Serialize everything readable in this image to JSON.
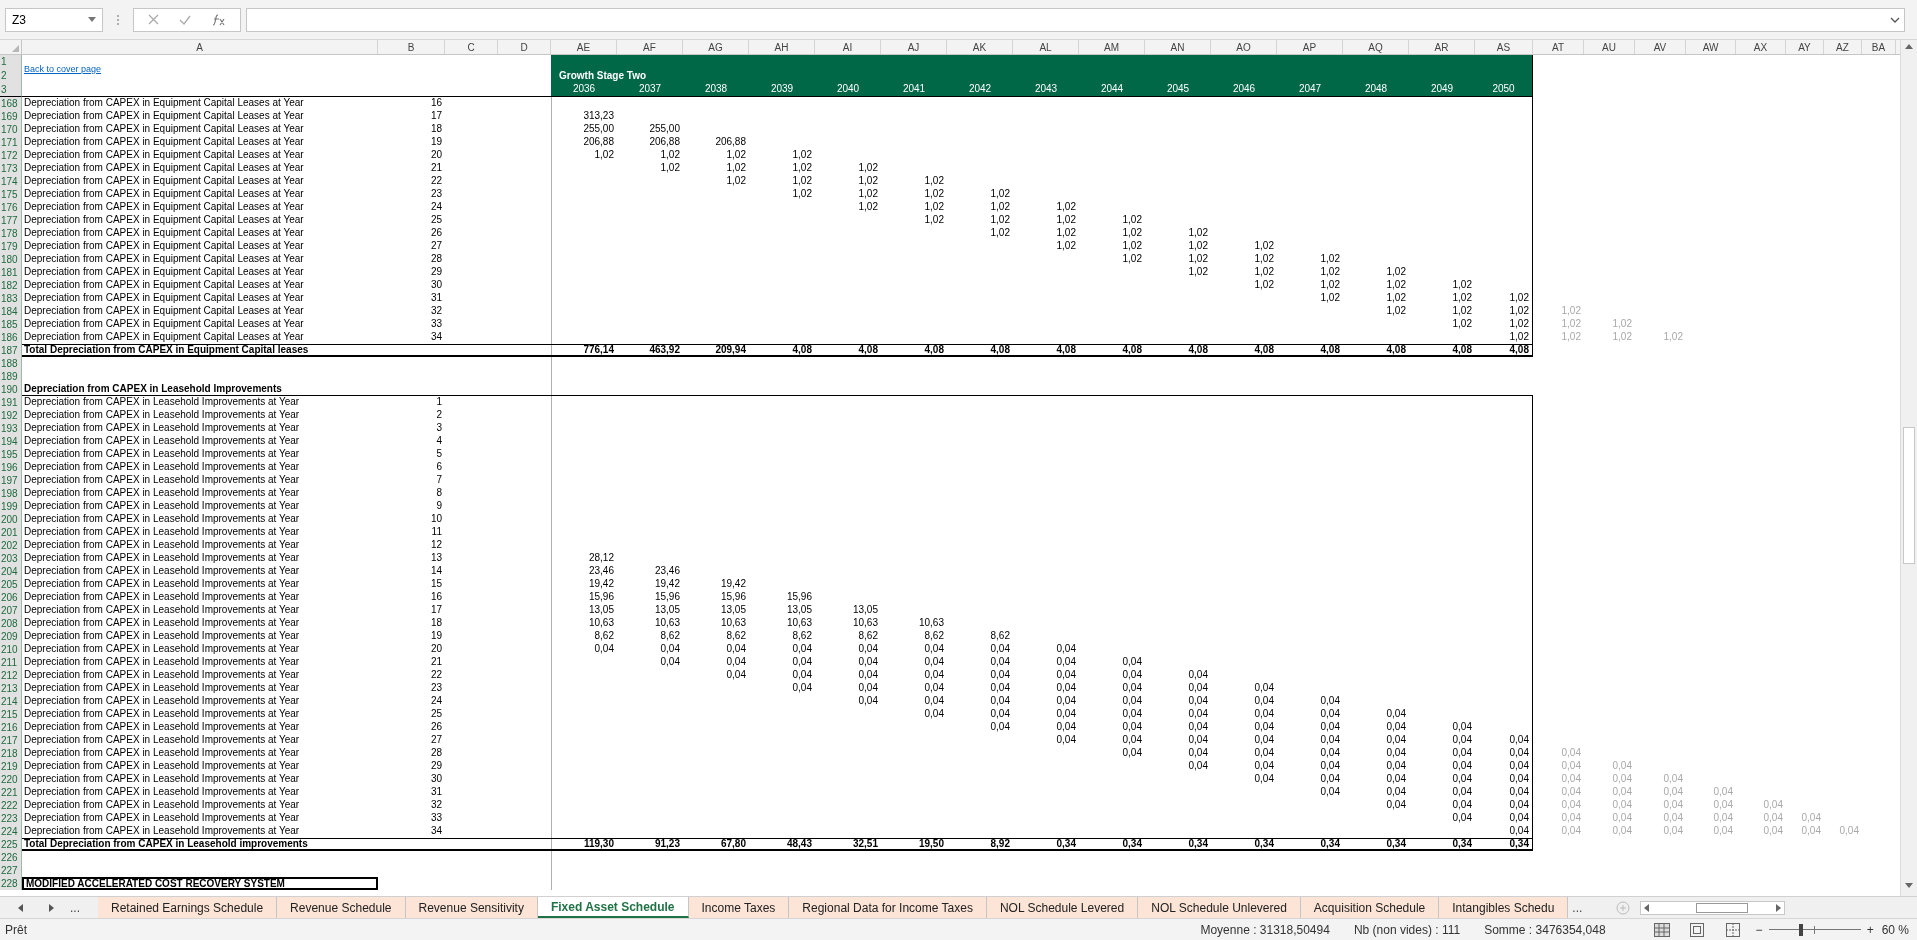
{
  "formula_bar": {
    "name_box": "Z3"
  },
  "columns": [
    {
      "letter": "A"
    },
    {
      "letter": "B"
    },
    {
      "letter": "C"
    },
    {
      "letter": "D"
    },
    {
      "letter": "AE"
    },
    {
      "letter": "AF"
    },
    {
      "letter": "AG"
    },
    {
      "letter": "AH"
    },
    {
      "letter": "AI"
    },
    {
      "letter": "AJ"
    },
    {
      "letter": "AK"
    },
    {
      "letter": "AL"
    },
    {
      "letter": "AM"
    },
    {
      "letter": "AN"
    },
    {
      "letter": "AO"
    },
    {
      "letter": "AP"
    },
    {
      "letter": "AQ"
    },
    {
      "letter": "AR"
    },
    {
      "letter": "AS"
    },
    {
      "letter": "AT",
      "dimmed": true
    },
    {
      "letter": "AU",
      "dimmed": true
    },
    {
      "letter": "AV",
      "dimmed": true
    },
    {
      "letter": "AW",
      "dimmed": true
    },
    {
      "letter": "AX",
      "dimmed": true
    },
    {
      "letter": "AY",
      "dimmed": true
    },
    {
      "letter": "AZ",
      "dimmed": true
    },
    {
      "letter": "BA"
    }
  ],
  "header": {
    "row_numbers": [
      "1",
      "2",
      "3"
    ],
    "link": "Back to cover page",
    "band_title": "Growth Stage Two",
    "years": [
      "2036",
      "2037",
      "2038",
      "2039",
      "2040",
      "2041",
      "2042",
      "2043",
      "2044",
      "2045",
      "2046",
      "2047",
      "2048",
      "2049",
      "2050"
    ]
  },
  "rows": [
    {
      "num": "168",
      "kind": "item",
      "cells": {
        "A": "Depreciation from CAPEX in Equipment Capital Leases at Year",
        "B": "16"
      }
    },
    {
      "num": "169",
      "kind": "item",
      "cells": {
        "A": "Depreciation from CAPEX in Equipment Capital Leases at Year",
        "B": "17",
        "AE": "313,23"
      }
    },
    {
      "num": "170",
      "kind": "item",
      "cells": {
        "A": "Depreciation from CAPEX in Equipment Capital Leases at Year",
        "B": "18",
        "AE": "255,00",
        "AF": "255,00"
      }
    },
    {
      "num": "171",
      "kind": "item",
      "cells": {
        "A": "Depreciation from CAPEX in Equipment Capital Leases at Year",
        "B": "19",
        "AE": "206,88",
        "AF": "206,88",
        "AG": "206,88"
      }
    },
    {
      "num": "172",
      "kind": "item",
      "cells": {
        "A": "Depreciation from CAPEX in Equipment Capital Leases at Year",
        "B": "20",
        "AE": "1,02",
        "AF": "1,02",
        "AG": "1,02",
        "AH": "1,02"
      }
    },
    {
      "num": "173",
      "kind": "item",
      "cells": {
        "A": "Depreciation from CAPEX in Equipment Capital Leases at Year",
        "B": "21",
        "AF": "1,02",
        "AG": "1,02",
        "AH": "1,02",
        "AI": "1,02"
      }
    },
    {
      "num": "174",
      "kind": "item",
      "cells": {
        "A": "Depreciation from CAPEX in Equipment Capital Leases at Year",
        "B": "22",
        "AG": "1,02",
        "AH": "1,02",
        "AI": "1,02",
        "AJ": "1,02"
      }
    },
    {
      "num": "175",
      "kind": "item",
      "cells": {
        "A": "Depreciation from CAPEX in Equipment Capital Leases at Year",
        "B": "23",
        "AH": "1,02",
        "AI": "1,02",
        "AJ": "1,02",
        "AK": "1,02"
      }
    },
    {
      "num": "176",
      "kind": "item",
      "cells": {
        "A": "Depreciation from CAPEX in Equipment Capital Leases at Year",
        "B": "24",
        "AI": "1,02",
        "AJ": "1,02",
        "AK": "1,02",
        "AL": "1,02"
      }
    },
    {
      "num": "177",
      "kind": "item",
      "cells": {
        "A": "Depreciation from CAPEX in Equipment Capital Leases at Year",
        "B": "25",
        "AJ": "1,02",
        "AK": "1,02",
        "AL": "1,02",
        "AM": "1,02"
      }
    },
    {
      "num": "178",
      "kind": "item",
      "cells": {
        "A": "Depreciation from CAPEX in Equipment Capital Leases at Year",
        "B": "26",
        "AK": "1,02",
        "AL": "1,02",
        "AM": "1,02",
        "AN": "1,02"
      }
    },
    {
      "num": "179",
      "kind": "item",
      "cells": {
        "A": "Depreciation from CAPEX in Equipment Capital Leases at Year",
        "B": "27",
        "AL": "1,02",
        "AM": "1,02",
        "AN": "1,02",
        "AO": "1,02"
      }
    },
    {
      "num": "180",
      "kind": "item",
      "cells": {
        "A": "Depreciation from CAPEX in Equipment Capital Leases at Year",
        "B": "28",
        "AM": "1,02",
        "AN": "1,02",
        "AO": "1,02",
        "AP": "1,02"
      }
    },
    {
      "num": "181",
      "kind": "item",
      "cells": {
        "A": "Depreciation from CAPEX in Equipment Capital Leases at Year",
        "B": "29",
        "AN": "1,02",
        "AO": "1,02",
        "AP": "1,02",
        "AQ": "1,02"
      }
    },
    {
      "num": "182",
      "kind": "item",
      "cells": {
        "A": "Depreciation from CAPEX in Equipment Capital Leases at Year",
        "B": "30",
        "AO": "1,02",
        "AP": "1,02",
        "AQ": "1,02",
        "AR": "1,02"
      }
    },
    {
      "num": "183",
      "kind": "item",
      "cells": {
        "A": "Depreciation from CAPEX in Equipment Capital Leases at Year",
        "B": "31",
        "AP": "1,02",
        "AQ": "1,02",
        "AR": "1,02",
        "AS": "1,02"
      }
    },
    {
      "num": "184",
      "kind": "item",
      "cells": {
        "A": "Depreciation from CAPEX in Equipment Capital Leases at Year",
        "B": "32",
        "AQ": "1,02",
        "AR": "1,02",
        "AS": "1,02",
        "AT": "1,02"
      }
    },
    {
      "num": "185",
      "kind": "item",
      "cells": {
        "A": "Depreciation from CAPEX in Equipment Capital Leases at Year",
        "B": "33",
        "AR": "1,02",
        "AS": "1,02",
        "AT": "1,02",
        "AU": "1,02"
      }
    },
    {
      "num": "186",
      "kind": "item",
      "cells": {
        "A": "Depreciation from CAPEX in Equipment Capital Leases at Year",
        "B": "34",
        "AS": "1,02",
        "AT": "1,02",
        "AU": "1,02",
        "AV": "1,02"
      }
    },
    {
      "num": "187",
      "kind": "total",
      "cells": {
        "A": "Total Depreciation from CAPEX in Equipment Capital leases",
        "AE": "776,14",
        "AF": "463,92",
        "AG": "209,94",
        "AH": "4,08",
        "AI": "4,08",
        "AJ": "4,08",
        "AK": "4,08",
        "AL": "4,08",
        "AM": "4,08",
        "AN": "4,08",
        "AO": "4,08",
        "AP": "4,08",
        "AQ": "4,08",
        "AR": "4,08",
        "AS": "4,08"
      }
    },
    {
      "num": "188",
      "kind": "blank"
    },
    {
      "num": "189",
      "kind": "blank"
    },
    {
      "num": "190",
      "kind": "section",
      "cells": {
        "A": "Depreciation from CAPEX in Leasehold Improvements"
      }
    },
    {
      "num": "191",
      "kind": "item",
      "cells": {
        "A": "Depreciation from CAPEX in Leasehold Improvements at Year",
        "B": "1"
      }
    },
    {
      "num": "192",
      "kind": "item",
      "cells": {
        "A": "Depreciation from CAPEX in Leasehold Improvements at Year",
        "B": "2"
      }
    },
    {
      "num": "193",
      "kind": "item",
      "cells": {
        "A": "Depreciation from CAPEX in Leasehold Improvements at Year",
        "B": "3"
      }
    },
    {
      "num": "194",
      "kind": "item",
      "cells": {
        "A": "Depreciation from CAPEX in Leasehold Improvements at Year",
        "B": "4"
      }
    },
    {
      "num": "195",
      "kind": "item",
      "cells": {
        "A": "Depreciation from CAPEX in Leasehold Improvements at Year",
        "B": "5"
      }
    },
    {
      "num": "196",
      "kind": "item",
      "cells": {
        "A": "Depreciation from CAPEX in Leasehold Improvements at Year",
        "B": "6"
      }
    },
    {
      "num": "197",
      "kind": "item",
      "cells": {
        "A": "Depreciation from CAPEX in Leasehold Improvements at Year",
        "B": "7"
      }
    },
    {
      "num": "198",
      "kind": "item",
      "cells": {
        "A": "Depreciation from CAPEX in Leasehold Improvements at Year",
        "B": "8"
      }
    },
    {
      "num": "199",
      "kind": "item",
      "cells": {
        "A": "Depreciation from CAPEX in Leasehold Improvements at Year",
        "B": "9"
      }
    },
    {
      "num": "200",
      "kind": "item",
      "cells": {
        "A": "Depreciation from CAPEX in Leasehold Improvements at Year",
        "B": "10"
      }
    },
    {
      "num": "201",
      "kind": "item",
      "cells": {
        "A": "Depreciation from CAPEX in Leasehold Improvements at Year",
        "B": "11"
      }
    },
    {
      "num": "202",
      "kind": "item",
      "cells": {
        "A": "Depreciation from CAPEX in Leasehold Improvements at Year",
        "B": "12"
      }
    },
    {
      "num": "203",
      "kind": "item",
      "cells": {
        "A": "Depreciation from CAPEX in Leasehold Improvements at Year",
        "B": "13",
        "AE": "28,12"
      }
    },
    {
      "num": "204",
      "kind": "item",
      "cells": {
        "A": "Depreciation from CAPEX in Leasehold Improvements at Year",
        "B": "14",
        "AE": "23,46",
        "AF": "23,46"
      }
    },
    {
      "num": "205",
      "kind": "item",
      "cells": {
        "A": "Depreciation from CAPEX in Leasehold Improvements at Year",
        "B": "15",
        "AE": "19,42",
        "AF": "19,42",
        "AG": "19,42"
      }
    },
    {
      "num": "206",
      "kind": "item",
      "cells": {
        "A": "Depreciation from CAPEX in Leasehold Improvements at Year",
        "B": "16",
        "AE": "15,96",
        "AF": "15,96",
        "AG": "15,96",
        "AH": "15,96"
      }
    },
    {
      "num": "207",
      "kind": "item",
      "cells": {
        "A": "Depreciation from CAPEX in Leasehold Improvements at Year",
        "B": "17",
        "AE": "13,05",
        "AF": "13,05",
        "AG": "13,05",
        "AH": "13,05",
        "AI": "13,05"
      }
    },
    {
      "num": "208",
      "kind": "item",
      "cells": {
        "A": "Depreciation from CAPEX in Leasehold Improvements at Year",
        "B": "18",
        "AE": "10,63",
        "AF": "10,63",
        "AG": "10,63",
        "AH": "10,63",
        "AI": "10,63",
        "AJ": "10,63"
      }
    },
    {
      "num": "209",
      "kind": "item",
      "cells": {
        "A": "Depreciation from CAPEX in Leasehold Improvements at Year",
        "B": "19",
        "AE": "8,62",
        "AF": "8,62",
        "AG": "8,62",
        "AH": "8,62",
        "AI": "8,62",
        "AJ": "8,62",
        "AK": "8,62"
      }
    },
    {
      "num": "210",
      "kind": "item",
      "cells": {
        "A": "Depreciation from CAPEX in Leasehold Improvements at Year",
        "B": "20",
        "AE": "0,04",
        "AF": "0,04",
        "AG": "0,04",
        "AH": "0,04",
        "AI": "0,04",
        "AJ": "0,04",
        "AK": "0,04",
        "AL": "0,04"
      }
    },
    {
      "num": "211",
      "kind": "item",
      "cells": {
        "A": "Depreciation from CAPEX in Leasehold Improvements at Year",
        "B": "21",
        "AF": "0,04",
        "AG": "0,04",
        "AH": "0,04",
        "AI": "0,04",
        "AJ": "0,04",
        "AK": "0,04",
        "AL": "0,04",
        "AM": "0,04"
      }
    },
    {
      "num": "212",
      "kind": "item",
      "cells": {
        "A": "Depreciation from CAPEX in Leasehold Improvements at Year",
        "B": "22",
        "AG": "0,04",
        "AH": "0,04",
        "AI": "0,04",
        "AJ": "0,04",
        "AK": "0,04",
        "AL": "0,04",
        "AM": "0,04",
        "AN": "0,04"
      }
    },
    {
      "num": "213",
      "kind": "item",
      "cells": {
        "A": "Depreciation from CAPEX in Leasehold Improvements at Year",
        "B": "23",
        "AH": "0,04",
        "AI": "0,04",
        "AJ": "0,04",
        "AK": "0,04",
        "AL": "0,04",
        "AM": "0,04",
        "AN": "0,04",
        "AO": "0,04"
      }
    },
    {
      "num": "214",
      "kind": "item",
      "cells": {
        "A": "Depreciation from CAPEX in Leasehold Improvements at Year",
        "B": "24",
        "AI": "0,04",
        "AJ": "0,04",
        "AK": "0,04",
        "AL": "0,04",
        "AM": "0,04",
        "AN": "0,04",
        "AO": "0,04",
        "AP": "0,04"
      }
    },
    {
      "num": "215",
      "kind": "item",
      "cells": {
        "A": "Depreciation from CAPEX in Leasehold Improvements at Year",
        "B": "25",
        "AJ": "0,04",
        "AK": "0,04",
        "AL": "0,04",
        "AM": "0,04",
        "AN": "0,04",
        "AO": "0,04",
        "AP": "0,04",
        "AQ": "0,04"
      }
    },
    {
      "num": "216",
      "kind": "item",
      "cells": {
        "A": "Depreciation from CAPEX in Leasehold Improvements at Year",
        "B": "26",
        "AK": "0,04",
        "AL": "0,04",
        "AM": "0,04",
        "AN": "0,04",
        "AO": "0,04",
        "AP": "0,04",
        "AQ": "0,04",
        "AR": "0,04"
      }
    },
    {
      "num": "217",
      "kind": "item",
      "cells": {
        "A": "Depreciation from CAPEX in Leasehold Improvements at Year",
        "B": "27",
        "AL": "0,04",
        "AM": "0,04",
        "AN": "0,04",
        "AO": "0,04",
        "AP": "0,04",
        "AQ": "0,04",
        "AR": "0,04",
        "AS": "0,04"
      }
    },
    {
      "num": "218",
      "kind": "item",
      "cells": {
        "A": "Depreciation from CAPEX in Leasehold Improvements at Year",
        "B": "28",
        "AM": "0,04",
        "AN": "0,04",
        "AO": "0,04",
        "AP": "0,04",
        "AQ": "0,04",
        "AR": "0,04",
        "AS": "0,04",
        "AT": "0,04"
      }
    },
    {
      "num": "219",
      "kind": "item",
      "cells": {
        "A": "Depreciation from CAPEX in Leasehold Improvements at Year",
        "B": "29",
        "AN": "0,04",
        "AO": "0,04",
        "AP": "0,04",
        "AQ": "0,04",
        "AR": "0,04",
        "AS": "0,04",
        "AT": "0,04",
        "AU": "0,04"
      }
    },
    {
      "num": "220",
      "kind": "item",
      "cells": {
        "A": "Depreciation from CAPEX in Leasehold Improvements at Year",
        "B": "30",
        "AO": "0,04",
        "AP": "0,04",
        "AQ": "0,04",
        "AR": "0,04",
        "AS": "0,04",
        "AT": "0,04",
        "AU": "0,04",
        "AV": "0,04"
      }
    },
    {
      "num": "221",
      "kind": "item",
      "cells": {
        "A": "Depreciation from CAPEX in Leasehold Improvements at Year",
        "B": "31",
        "AP": "0,04",
        "AQ": "0,04",
        "AR": "0,04",
        "AS": "0,04",
        "AT": "0,04",
        "AU": "0,04",
        "AV": "0,04",
        "AW": "0,04"
      }
    },
    {
      "num": "222",
      "kind": "item",
      "cells": {
        "A": "Depreciation from CAPEX in Leasehold Improvements at Year",
        "B": "32",
        "AQ": "0,04",
        "AR": "0,04",
        "AS": "0,04",
        "AT": "0,04",
        "AU": "0,04",
        "AV": "0,04",
        "AW": "0,04",
        "AX": "0,04"
      }
    },
    {
      "num": "223",
      "kind": "item",
      "cells": {
        "A": "Depreciation from CAPEX in Leasehold Improvements at Year",
        "B": "33",
        "AR": "0,04",
        "AS": "0,04",
        "AT": "0,04",
        "AU": "0,04",
        "AV": "0,04",
        "AW": "0,04",
        "AX": "0,04",
        "AY": "0,04"
      }
    },
    {
      "num": "224",
      "kind": "item",
      "cells": {
        "A": "Depreciation from CAPEX in Leasehold Improvements at Year",
        "B": "34",
        "AS": "0,04",
        "AT": "0,04",
        "AU": "0,04",
        "AV": "0,04",
        "AW": "0,04",
        "AX": "0,04",
        "AY": "0,04",
        "AZ": "0,04"
      }
    },
    {
      "num": "225",
      "kind": "total",
      "cells": {
        "A": "Total Depreciation from CAPEX in Leasehold improvements",
        "AE": "119,30",
        "AF": "91,23",
        "AG": "67,80",
        "AH": "48,43",
        "AI": "32,51",
        "AJ": "19,50",
        "AK": "8,92",
        "AL": "0,34",
        "AM": "0,34",
        "AN": "0,34",
        "AO": "0,34",
        "AP": "0,34",
        "AQ": "0,34",
        "AR": "0,34",
        "AS": "0,34"
      }
    },
    {
      "num": "226",
      "kind": "blank"
    },
    {
      "num": "227",
      "kind": "blank"
    },
    {
      "num": "228",
      "kind": "boxed",
      "cells": {
        "A": "MODIFIED  ACCELERATED COST RECOVERY SYSTEM"
      }
    }
  ],
  "sheet_tabs": {
    "overflow_left": "...",
    "tabs": [
      {
        "label": "Retained Earnings Schedule",
        "selected": false
      },
      {
        "label": "Revenue Schedule",
        "selected": false
      },
      {
        "label": "Revenue Sensitivity",
        "selected": false
      },
      {
        "label": "Fixed Asset Schedule",
        "selected": true
      },
      {
        "label": "Income Taxes",
        "selected": false
      },
      {
        "label": "Regional Data for Income Taxes",
        "selected": false
      },
      {
        "label": "NOL Schedule Levered",
        "selected": false
      },
      {
        "label": "NOL Schedule Unlevered",
        "selected": false
      },
      {
        "label": "Acquisition Schedule",
        "selected": false
      },
      {
        "label": "Intangibles Schedu",
        "selected": false
      }
    ],
    "overflow_right": "..."
  },
  "status_bar": {
    "mode": "Prêt",
    "average": "Moyenne : 31318,50494",
    "count": "Nb (non vides) : 111",
    "sum": "Somme : 3476354,048",
    "zoom_out": "−",
    "zoom_in": "+",
    "zoom_level": "60 %",
    "zoom_slider": {
      "level": 0.35
    }
  }
}
